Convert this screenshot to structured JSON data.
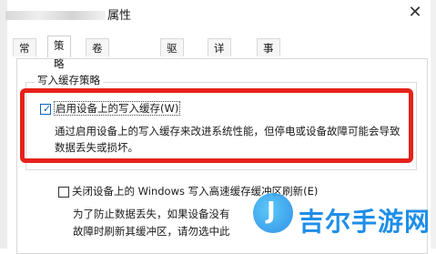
{
  "window": {
    "title": "属性",
    "close_glyph": "✕"
  },
  "tabs": [
    {
      "label": "常规",
      "active": false
    },
    {
      "label": "策略",
      "active": true
    },
    {
      "label": "卷",
      "active": false
    },
    {
      "label": "驱动程序",
      "active": false
    },
    {
      "label": "详细信息",
      "active": false
    },
    {
      "label": "事件",
      "active": false
    }
  ],
  "write_cache": {
    "group_title": "写入缓存策略",
    "enable_label": "启用设备上的写入缓存",
    "enable_accel": "(W)",
    "enable_checked": true,
    "enable_description": "通过启用设备上的写入缓存来改进系统性能，但停电或设备故障可能会导致数据丢失或损坏。",
    "flush_label": "关闭设备上的 Windows 写入高速缓存缓冲区刷新(E)",
    "flush_checked": false,
    "flush_description_line1": "为了防止数据丢失，如果设备没有",
    "flush_description_line2": "故障时刷新其缓冲区，请勿选中此"
  },
  "annotation": {
    "color": "#e5221a"
  },
  "watermark": {
    "text": "吉尔手游网",
    "logo_letter": "J"
  }
}
